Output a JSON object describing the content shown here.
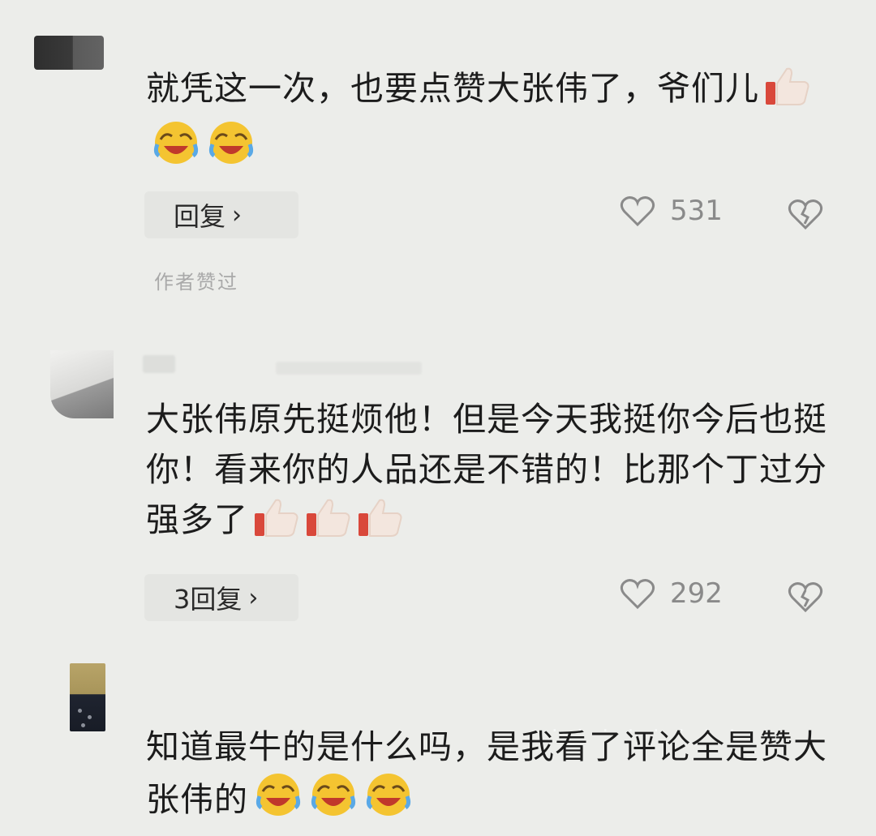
{
  "comments": [
    {
      "text": "就凭这一次，也要点赞大张伟了，爷们儿",
      "reply_label": "回复",
      "likes": "531",
      "author_liked_label": "作者赞过"
    },
    {
      "text": "大张伟原先挺烦他！但是今天我挺你今后也挺你！看来你的人品还是不错的！比那个丁过分强多了",
      "reply_label": "3回复",
      "likes": "292"
    },
    {
      "text": "知道最牛的是什么吗，是我看了评论全是赞大张伟的"
    }
  ],
  "icons": {
    "like": "heart-outline-icon",
    "dislike": "broken-heart-icon",
    "reply_chevron": "chevron-right-icon",
    "thumbs_up": "thumbs-up-emoji",
    "laugh_cry": "laugh-cry-emoji"
  },
  "colors": {
    "background": "#ecedea",
    "text": "#1c1c1c",
    "muted": "#8a8a8a"
  }
}
